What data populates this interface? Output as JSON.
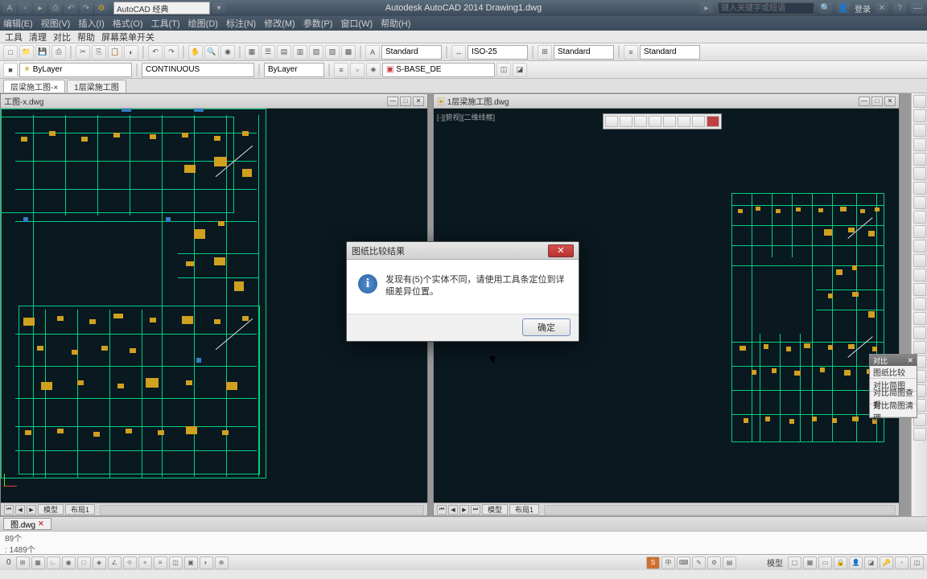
{
  "app": {
    "title": "Autodesk AutoCAD 2014    Drawing1.dwg",
    "workspace": "AutoCAD 经典",
    "search_placeholder": "键入关键字或短语",
    "login": "登录"
  },
  "menu": {
    "items": [
      "编辑(E)",
      "视图(V)",
      "插入(I)",
      "格式(O)",
      "工具(T)",
      "绘图(D)",
      "标注(N)",
      "修改(M)",
      "参数(P)",
      "窗口(W)",
      "帮助(H)"
    ]
  },
  "sec_bar": {
    "items": [
      "工具",
      "清理",
      "对比",
      "帮助",
      "屏幕菜单开关"
    ]
  },
  "toolbar2": {
    "layer": "ByLayer",
    "linetype": "CONTINUOUS",
    "color": "ByLayer",
    "style1": "Standard",
    "style2": "ISO-25",
    "style3": "Standard",
    "style4": "Standard",
    "sbase": "S-BASE_DE"
  },
  "tabs": {
    "items": [
      "层梁施工图-×",
      "1层梁施工图"
    ]
  },
  "panel_left": {
    "title": "工图-x.dwg"
  },
  "panel_right": {
    "title": "1层梁施工图.dwg",
    "viewport_label": "[-][俯视][二维线框]"
  },
  "model_tabs": {
    "model": "模型",
    "layout": "布局1"
  },
  "dialog": {
    "title": "图纸比较结果",
    "message": "发现有(5)个实体不同，请使用工具条定位到详细差异位置。",
    "ok": "确定"
  },
  "float_panel": {
    "title": "对比",
    "items": [
      "图纸比较",
      "对比简图",
      "对比简图查看",
      "对比简图清理"
    ]
  },
  "doc_tabs": {
    "items": [
      "图.dwg"
    ]
  },
  "cmd": {
    "line1": "89个",
    "line2": ": 1489个"
  },
  "status": {
    "text": "0",
    "layout_label": "模型"
  }
}
